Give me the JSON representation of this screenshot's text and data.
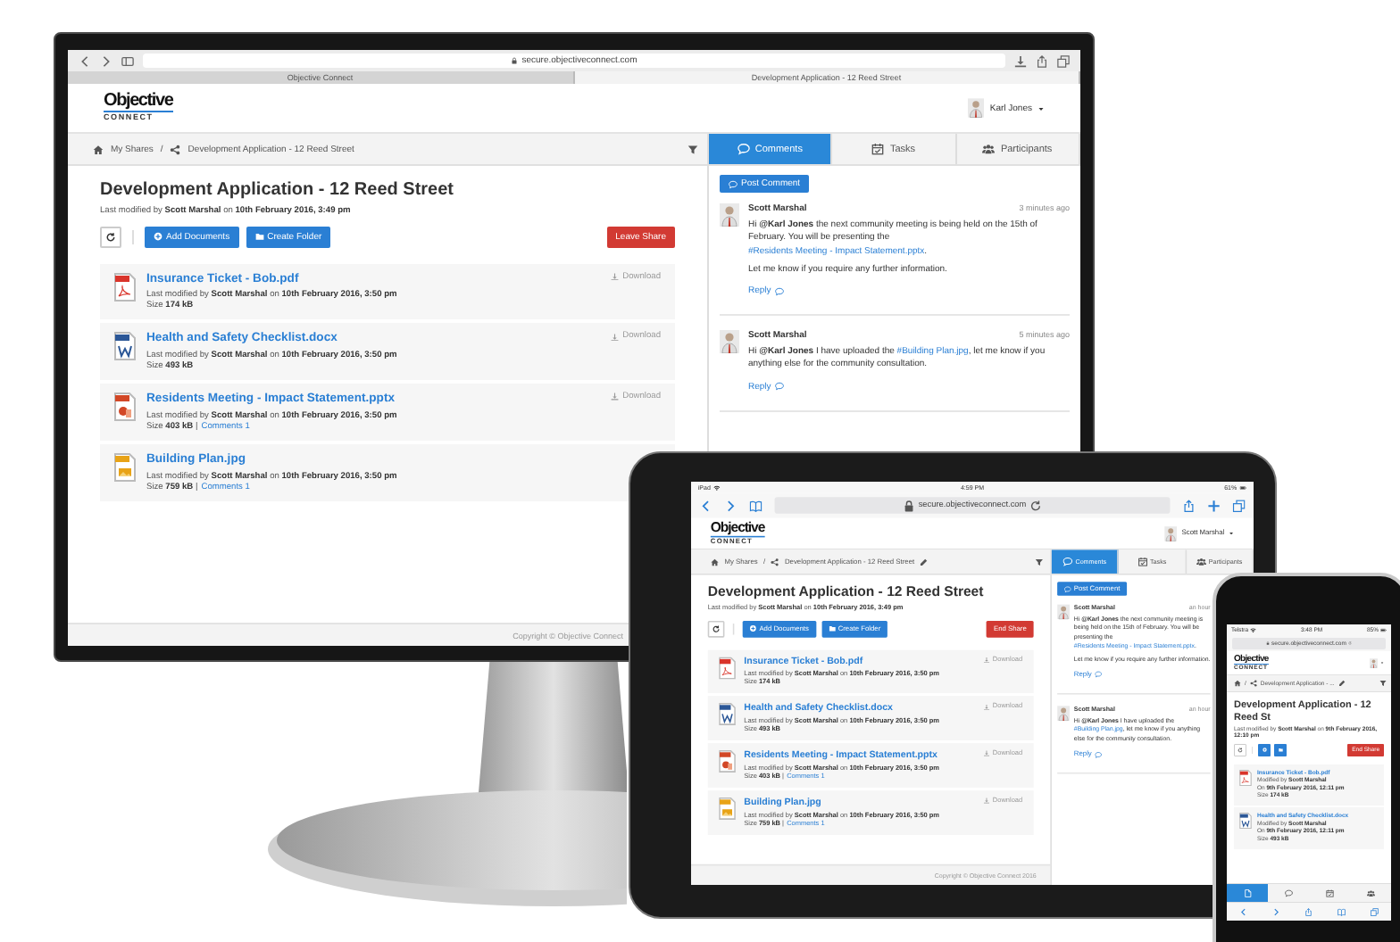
{
  "monitor": {
    "browser": {
      "url": "secure.objectiveconnect.com",
      "tabs": [
        {
          "label": "Objective Connect",
          "selected": false
        },
        {
          "label": "Development Application - 12 Reed Street",
          "selected": true
        }
      ]
    },
    "logo": {
      "word": "Objective",
      "sub": "CONNECT"
    },
    "user": "Karl Jones",
    "separator": "/",
    "breadcrumb": [
      {
        "kind": "home",
        "label": "My Shares"
      },
      {
        "kind": "share",
        "label": "Development Application - 12 Reed Street",
        "editable": false
      }
    ],
    "panel_tabs": [
      {
        "kind": "comments",
        "label": "Comments",
        "selected": true
      },
      {
        "kind": "tasks",
        "label": "Tasks",
        "selected": false
      },
      {
        "kind": "participants",
        "label": "Participants",
        "selected": false
      }
    ],
    "title": "Development Application - 12 Reed Street",
    "modified": "Last modified by **Scott Marshal** on **10th February 2016, 3:49 pm**",
    "add_button": "Add Documents",
    "folder_button": "Create Folder",
    "share_button": "Leave Share",
    "documents": [
      {
        "kind": "pdf",
        "name": "Insurance Ticket - Bob.pdf",
        "modified": "Last modified by **Scott Marshal** on **10th February 2016, 3:50 pm**",
        "size": "Size **174 kB**",
        "download": "Download"
      },
      {
        "kind": "docx",
        "name": "Health and Safety Checklist.docx",
        "modified": "Last modified by **Scott Marshal** on **10th February 2016, 3:50 pm**",
        "size": "Size **493 kB**",
        "download": "Download"
      },
      {
        "kind": "pptx",
        "name": "Residents Meeting - Impact Statement.pptx",
        "modified": "Last modified by **Scott Marshal** on **10th February 2016, 3:50 pm**",
        "size": "Size **403 kB** |",
        "comments": "Comments 1",
        "download": "Download"
      },
      {
        "kind": "jpg",
        "name": "Building Plan.jpg",
        "modified": "Last modified by **Scott Marshal** on **10th February 2016, 3:50 pm**",
        "size": "Size **759 kB** |",
        "comments": "Comments 1"
      }
    ],
    "post_button": "Post Comment",
    "comments": [
      {
        "author": "Scott Marshal",
        "time": "3 minutes ago",
        "paragraphs": [
          [
            {
              "kind": "text",
              "text": "Hi "
            },
            {
              "kind": "mention",
              "text": "@Karl Jones"
            },
            {
              "kind": "text",
              "text": " the next community meeting is being held on the 15th of February. You will be presenting the "
            },
            {
              "kind": "link",
              "text": "#Residents Meeting - Impact Statement.pptx"
            },
            {
              "kind": "text",
              "text": "."
            }
          ],
          [
            {
              "kind": "text",
              "text": "Let me know if you require any further information."
            }
          ]
        ],
        "reply": "Reply"
      },
      {
        "author": "Scott Marshal",
        "time": "5 minutes ago",
        "paragraphs": [
          [
            {
              "kind": "text",
              "text": "Hi "
            },
            {
              "kind": "mention",
              "text": "@Karl Jones"
            },
            {
              "kind": "text",
              "text": " I have uploaded the "
            },
            {
              "kind": "link",
              "text": "#Building Plan.jpg"
            },
            {
              "kind": "text",
              "text": ", let me know if you anything else for the community consultation."
            }
          ]
        ],
        "reply": "Reply"
      }
    ],
    "footer": "Copyright © Objective Connect"
  },
  "tablet": {
    "status": {
      "carrier": "iPad",
      "time": "4:59 PM",
      "battery": "61%"
    },
    "browser": {
      "url": "secure.objectiveconnect.com"
    },
    "logo": {
      "word": "Objective",
      "sub": "CONNECT"
    },
    "user": "Scott Marshal",
    "separator": "/",
    "breadcrumb": [
      {
        "kind": "home",
        "label": "My Shares"
      },
      {
        "kind": "share",
        "label": "Development Application - 12 Reed Street",
        "editable": true
      }
    ],
    "panel_tabs": [
      {
        "kind": "comments",
        "label": "Comments",
        "selected": true
      },
      {
        "kind": "tasks",
        "label": "Tasks",
        "selected": false
      },
      {
        "kind": "participants",
        "label": "Participants",
        "selected": false
      }
    ],
    "title": "Development Application - 12 Reed Street",
    "modified": "Last modified by **Scott Marshal** on **10th February 2016, 3:49 pm**",
    "add_button": "Add Documents",
    "folder_button": "Create Folder",
    "share_button": "End Share",
    "documents": [
      {
        "kind": "pdf",
        "name": "Insurance Ticket - Bob.pdf",
        "modified": "Last modified by **Scott Marshal** on **10th February 2016, 3:50 pm**",
        "size": "Size **174 kB**",
        "download": "Download"
      },
      {
        "kind": "docx",
        "name": "Health and Safety Checklist.docx",
        "modified": "Last modified by **Scott Marshal** on **10th February 2016, 3:50 pm**",
        "size": "Size **493 kB**",
        "download": "Download"
      },
      {
        "kind": "pptx",
        "name": "Residents Meeting - Impact Statement.pptx",
        "modified": "Last modified by **Scott Marshal** on **10th February 2016, 3:50 pm**",
        "size": "Size **403 kB** |",
        "comments": "Comments 1",
        "download": "Download"
      },
      {
        "kind": "jpg",
        "name": "Building Plan.jpg",
        "modified": "Last modified by **Scott Marshal** on **10th February 2016, 3:50 pm**",
        "size": "Size **759 kB** |",
        "comments": "Comments 1",
        "download": "Download"
      }
    ],
    "post_button": "Post Comment",
    "comments": [
      {
        "author": "Scott Marshal",
        "time": "an hour",
        "paragraphs": [
          [
            {
              "kind": "text",
              "text": "Hi "
            },
            {
              "kind": "mention",
              "text": "@Karl Jones"
            },
            {
              "kind": "text",
              "text": " the next community meeting is being held on the 15th of February. You will be presenting the "
            },
            {
              "kind": "link",
              "text": "#Residents Meeting - Impact Statement.pptx"
            },
            {
              "kind": "text",
              "text": "."
            }
          ],
          [
            {
              "kind": "text",
              "text": "Let me know if you require any further information."
            }
          ]
        ],
        "reply": "Reply"
      },
      {
        "author": "Scott Marshal",
        "time": "an hour",
        "paragraphs": [
          [
            {
              "kind": "text",
              "text": "Hi "
            },
            {
              "kind": "mention",
              "text": "@Karl Jones"
            },
            {
              "kind": "text",
              "text": " I have uploaded the "
            },
            {
              "kind": "link",
              "text": "#Building Plan.jpg"
            },
            {
              "kind": "text",
              "text": ", let me know if you anything else for the community consultation."
            }
          ]
        ],
        "reply": "Reply"
      }
    ],
    "footer": "Copyright © Objective Connect 2016"
  },
  "phone": {
    "status": {
      "carrier": "Telstra",
      "time": "3:48 PM",
      "battery": "85%"
    },
    "browser": {
      "url": "secure.objectiveconnect.com"
    },
    "logo": {
      "word": "Objective",
      "sub": "CONNECT"
    },
    "separator": "/",
    "breadcrumb": [
      {
        "kind": "home"
      },
      {
        "kind": "share",
        "label": "Development Application - ...",
        "editable": true
      }
    ],
    "title": "Development Application - 12 Reed St",
    "modified": "Last modified by **Scott Marshal** on **9th February 2016, 12:10 pm**",
    "share_button": "End Share",
    "documents": [
      {
        "kind": "pdf",
        "name": "Insurance Ticket - Bob.pdf",
        "lines": [
          "Modified by **Scott Marshal**",
          "On **9th February 2016, 12:11 pm**",
          "Size **174 kB**"
        ]
      },
      {
        "kind": "docx",
        "name": "Health and Safety Checklist.docx",
        "lines": [
          "Modified by **Scott Marshal**",
          "On **9th February 2016, 12:11 pm**",
          "Size **493 kB**"
        ]
      }
    ],
    "tabs": [
      {
        "kind": "documents",
        "selected": true
      },
      {
        "kind": "comments",
        "selected": false
      },
      {
        "kind": "tasks",
        "selected": false
      },
      {
        "kind": "participants",
        "selected": false
      }
    ]
  }
}
